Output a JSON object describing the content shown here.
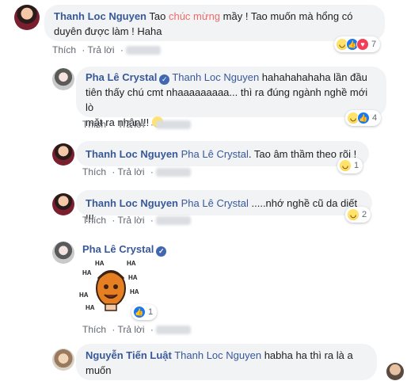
{
  "actions": {
    "like": "Thích",
    "reply": "Trả lời"
  },
  "comments": [
    {
      "author": "Thanh Loc Nguyen",
      "text_pre": "Tao ",
      "highlight": "chúc mừng",
      "text_line1_post": " mầy ! Tao muốn mà hổng có",
      "text_line2": "duyên được làm ! Haha",
      "reaction_count": "7"
    },
    {
      "author": "Pha Lê Crystal",
      "mention": "Thanh Loc Nguyen",
      "text_line1": " hahahahahaha lần đầu",
      "text_line2": "tiên thấy chú cmt nhaaaaaaaaa... thì ra đúng ngành nghề mới lò",
      "text_line3": "mặt ra nhận!!! ",
      "reaction_count": "4"
    },
    {
      "author": "Thanh Loc Nguyen",
      "mention": "Pha Lê Crystal",
      "text": ". Tao âm thầm theo rõi !",
      "reaction_count": "1"
    },
    {
      "author": "Thanh Loc Nguyen",
      "mention": "Pha Lê Crystal",
      "text": " .....nhớ nghề cũ da diết !!!",
      "reaction_count": "2"
    },
    {
      "author": "Pha Lê Crystal",
      "sticker_text": "HA",
      "reaction_count": "1"
    },
    {
      "author": "Nguyễn Tiến Luật",
      "mention": "Thanh Loc Nguyen",
      "text_line1": " habha ha thì ra là a",
      "text_line2": "muốn"
    }
  ],
  "colors": {
    "link": "#385898",
    "highlight": "#ec6a6a",
    "bubble": "#f2f3f5"
  }
}
